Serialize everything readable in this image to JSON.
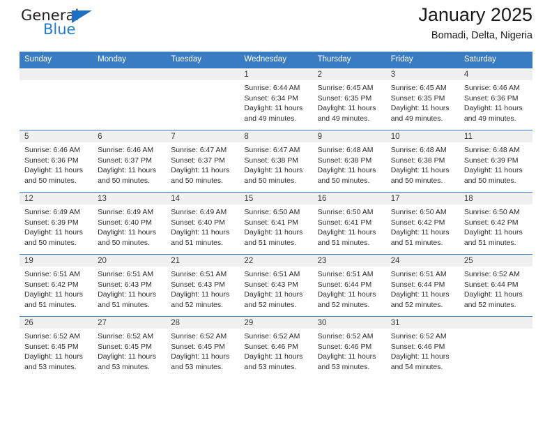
{
  "logo": {
    "word_top": "General",
    "word_bottom": "Blue",
    "triangle_icon": "triangle-icon",
    "blue": "#1f7dd0",
    "dark": "#231f20"
  },
  "header": {
    "title": "January 2025",
    "subtitle": "Bomadi, Delta, Nigeria"
  },
  "theme": {
    "header_blue": "#3a7cc2",
    "band_gray": "#f0f0f0"
  },
  "weekdays": [
    "Sunday",
    "Monday",
    "Tuesday",
    "Wednesday",
    "Thursday",
    "Friday",
    "Saturday"
  ],
  "labels": {
    "sunrise_prefix": "Sunrise:",
    "sunset_prefix": "Sunset:",
    "daylight_prefix": "Daylight:"
  },
  "weeks": [
    [
      {
        "day": "",
        "empty": true
      },
      {
        "day": "",
        "empty": true
      },
      {
        "day": "",
        "empty": true
      },
      {
        "day": "1",
        "sunrise": "Sunrise: 6:44 AM",
        "sunset": "Sunset: 6:34 PM",
        "daylight": "Daylight: 11 hours and 49 minutes."
      },
      {
        "day": "2",
        "sunrise": "Sunrise: 6:45 AM",
        "sunset": "Sunset: 6:35 PM",
        "daylight": "Daylight: 11 hours and 49 minutes."
      },
      {
        "day": "3",
        "sunrise": "Sunrise: 6:45 AM",
        "sunset": "Sunset: 6:35 PM",
        "daylight": "Daylight: 11 hours and 49 minutes."
      },
      {
        "day": "4",
        "sunrise": "Sunrise: 6:46 AM",
        "sunset": "Sunset: 6:36 PM",
        "daylight": "Daylight: 11 hours and 49 minutes."
      }
    ],
    [
      {
        "day": "5",
        "sunrise": "Sunrise: 6:46 AM",
        "sunset": "Sunset: 6:36 PM",
        "daylight": "Daylight: 11 hours and 50 minutes."
      },
      {
        "day": "6",
        "sunrise": "Sunrise: 6:46 AM",
        "sunset": "Sunset: 6:37 PM",
        "daylight": "Daylight: 11 hours and 50 minutes."
      },
      {
        "day": "7",
        "sunrise": "Sunrise: 6:47 AM",
        "sunset": "Sunset: 6:37 PM",
        "daylight": "Daylight: 11 hours and 50 minutes."
      },
      {
        "day": "8",
        "sunrise": "Sunrise: 6:47 AM",
        "sunset": "Sunset: 6:38 PM",
        "daylight": "Daylight: 11 hours and 50 minutes."
      },
      {
        "day": "9",
        "sunrise": "Sunrise: 6:48 AM",
        "sunset": "Sunset: 6:38 PM",
        "daylight": "Daylight: 11 hours and 50 minutes."
      },
      {
        "day": "10",
        "sunrise": "Sunrise: 6:48 AM",
        "sunset": "Sunset: 6:38 PM",
        "daylight": "Daylight: 11 hours and 50 minutes."
      },
      {
        "day": "11",
        "sunrise": "Sunrise: 6:48 AM",
        "sunset": "Sunset: 6:39 PM",
        "daylight": "Daylight: 11 hours and 50 minutes."
      }
    ],
    [
      {
        "day": "12",
        "sunrise": "Sunrise: 6:49 AM",
        "sunset": "Sunset: 6:39 PM",
        "daylight": "Daylight: 11 hours and 50 minutes."
      },
      {
        "day": "13",
        "sunrise": "Sunrise: 6:49 AM",
        "sunset": "Sunset: 6:40 PM",
        "daylight": "Daylight: 11 hours and 50 minutes."
      },
      {
        "day": "14",
        "sunrise": "Sunrise: 6:49 AM",
        "sunset": "Sunset: 6:40 PM",
        "daylight": "Daylight: 11 hours and 51 minutes."
      },
      {
        "day": "15",
        "sunrise": "Sunrise: 6:50 AM",
        "sunset": "Sunset: 6:41 PM",
        "daylight": "Daylight: 11 hours and 51 minutes."
      },
      {
        "day": "16",
        "sunrise": "Sunrise: 6:50 AM",
        "sunset": "Sunset: 6:41 PM",
        "daylight": "Daylight: 11 hours and 51 minutes."
      },
      {
        "day": "17",
        "sunrise": "Sunrise: 6:50 AM",
        "sunset": "Sunset: 6:42 PM",
        "daylight": "Daylight: 11 hours and 51 minutes."
      },
      {
        "day": "18",
        "sunrise": "Sunrise: 6:50 AM",
        "sunset": "Sunset: 6:42 PM",
        "daylight": "Daylight: 11 hours and 51 minutes."
      }
    ],
    [
      {
        "day": "19",
        "sunrise": "Sunrise: 6:51 AM",
        "sunset": "Sunset: 6:42 PM",
        "daylight": "Daylight: 11 hours and 51 minutes."
      },
      {
        "day": "20",
        "sunrise": "Sunrise: 6:51 AM",
        "sunset": "Sunset: 6:43 PM",
        "daylight": "Daylight: 11 hours and 51 minutes."
      },
      {
        "day": "21",
        "sunrise": "Sunrise: 6:51 AM",
        "sunset": "Sunset: 6:43 PM",
        "daylight": "Daylight: 11 hours and 52 minutes."
      },
      {
        "day": "22",
        "sunrise": "Sunrise: 6:51 AM",
        "sunset": "Sunset: 6:43 PM",
        "daylight": "Daylight: 11 hours and 52 minutes."
      },
      {
        "day": "23",
        "sunrise": "Sunrise: 6:51 AM",
        "sunset": "Sunset: 6:44 PM",
        "daylight": "Daylight: 11 hours and 52 minutes."
      },
      {
        "day": "24",
        "sunrise": "Sunrise: 6:51 AM",
        "sunset": "Sunset: 6:44 PM",
        "daylight": "Daylight: 11 hours and 52 minutes."
      },
      {
        "day": "25",
        "sunrise": "Sunrise: 6:52 AM",
        "sunset": "Sunset: 6:44 PM",
        "daylight": "Daylight: 11 hours and 52 minutes."
      }
    ],
    [
      {
        "day": "26",
        "sunrise": "Sunrise: 6:52 AM",
        "sunset": "Sunset: 6:45 PM",
        "daylight": "Daylight: 11 hours and 53 minutes."
      },
      {
        "day": "27",
        "sunrise": "Sunrise: 6:52 AM",
        "sunset": "Sunset: 6:45 PM",
        "daylight": "Daylight: 11 hours and 53 minutes."
      },
      {
        "day": "28",
        "sunrise": "Sunrise: 6:52 AM",
        "sunset": "Sunset: 6:45 PM",
        "daylight": "Daylight: 11 hours and 53 minutes."
      },
      {
        "day": "29",
        "sunrise": "Sunrise: 6:52 AM",
        "sunset": "Sunset: 6:46 PM",
        "daylight": "Daylight: 11 hours and 53 minutes."
      },
      {
        "day": "30",
        "sunrise": "Sunrise: 6:52 AM",
        "sunset": "Sunset: 6:46 PM",
        "daylight": "Daylight: 11 hours and 53 minutes."
      },
      {
        "day": "31",
        "sunrise": "Sunrise: 6:52 AM",
        "sunset": "Sunset: 6:46 PM",
        "daylight": "Daylight: 11 hours and 54 minutes."
      },
      {
        "day": "",
        "empty": true
      }
    ]
  ]
}
